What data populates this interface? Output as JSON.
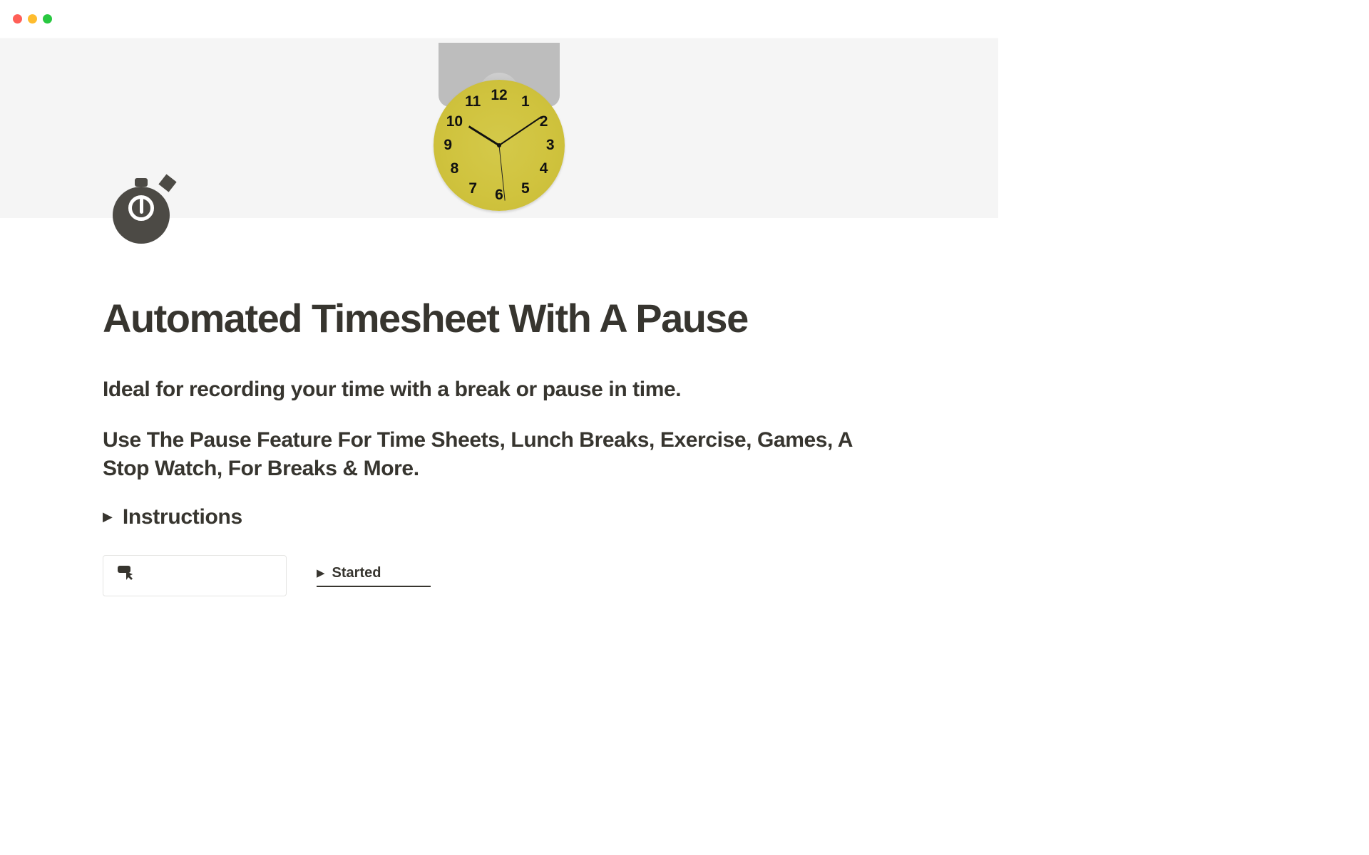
{
  "page": {
    "title": "Automated Timesheet With A Pause",
    "subhead1": "Ideal for recording your time with a break or pause in time.",
    "subhead2": "Use The Pause Feature For Time Sheets, Lunch Breaks, Exercise, Games, A Stop Watch, For Breaks & More."
  },
  "toggle": {
    "instructions_label": "Instructions"
  },
  "clock": {
    "numbers": [
      "12",
      "1",
      "2",
      "3",
      "4",
      "5",
      "6",
      "7",
      "8",
      "9",
      "10",
      "11"
    ]
  },
  "tabs": {
    "started_label": "Started"
  },
  "callout": {
    "icon_glyph": "👆"
  }
}
